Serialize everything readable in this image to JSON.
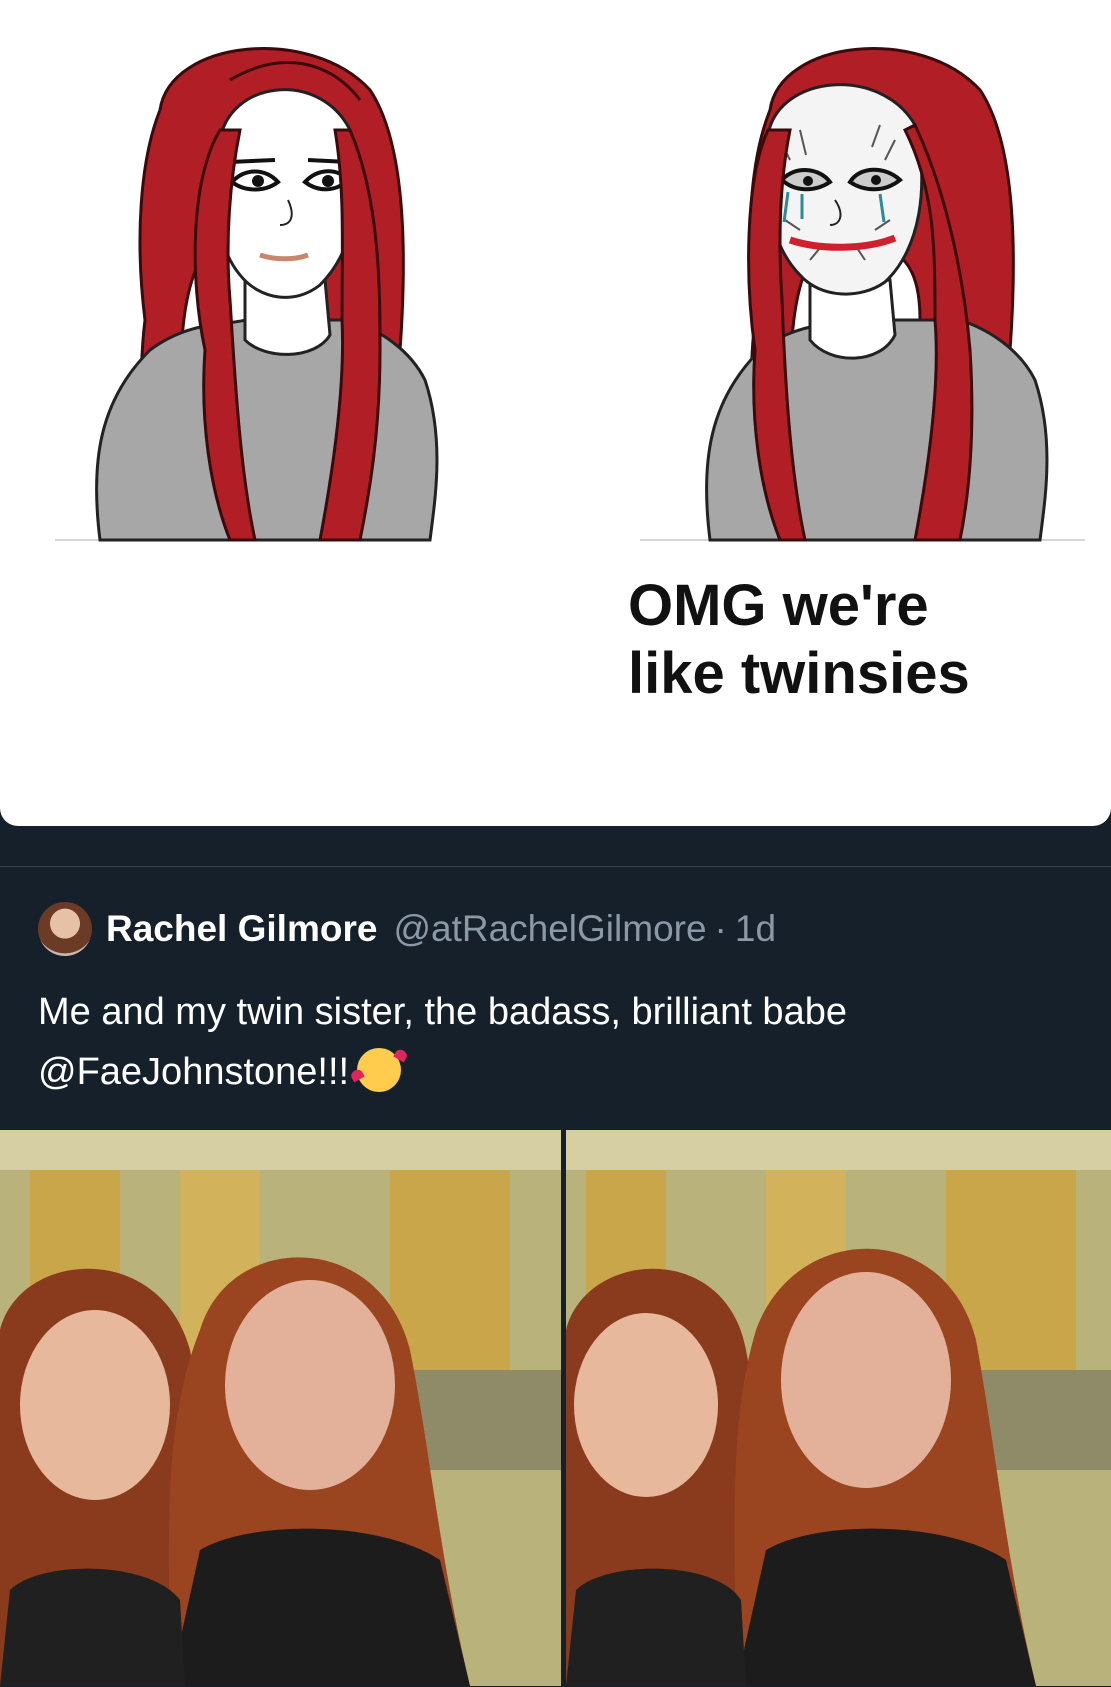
{
  "meme": {
    "caption_line1": "OMG we're",
    "caption_line2": "like twinsies",
    "left_panel": "smiling-girl-red-hair",
    "right_panel": "crying-joker-makeup-red-hair"
  },
  "tweet": {
    "display_name": "Rachel Gilmore",
    "handle": "@atRachelGilmore",
    "time": "1d",
    "separator": "·",
    "text_line1": "Me and my twin sister, the badass, brilliant babe",
    "text_line2": "@FaeJohnstone!!!",
    "emoji": "smiling-face-with-hearts"
  },
  "photos": [
    {
      "alt": "selfie-photo-1"
    },
    {
      "alt": "selfie-photo-2"
    }
  ],
  "colors": {
    "background": "#15202b",
    "hair": "#b11e26",
    "handle": "#8b98a5"
  }
}
